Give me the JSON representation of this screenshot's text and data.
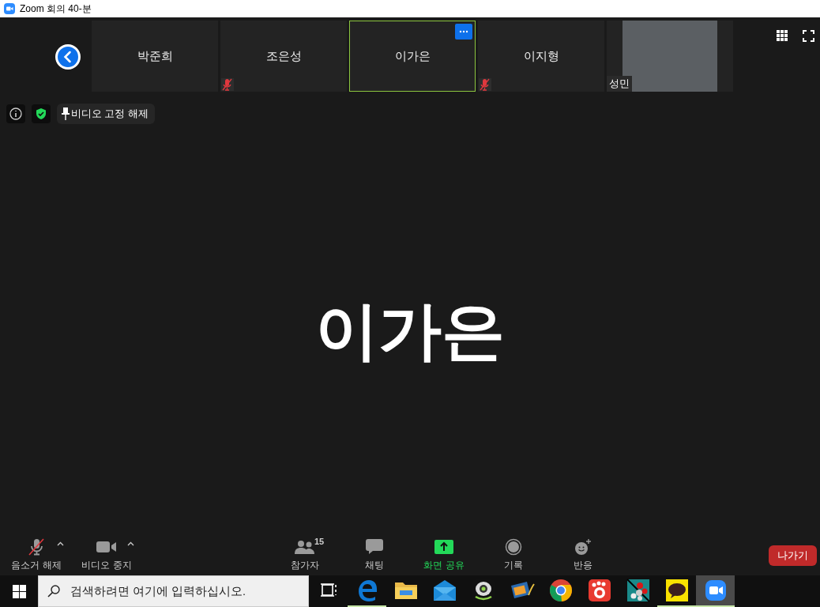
{
  "window": {
    "title": "Zoom 회의 40-분"
  },
  "thumbnails": [
    {
      "name": "박준희",
      "kind": "name",
      "muted": false,
      "selected": false
    },
    {
      "name": "조은성",
      "kind": "name",
      "muted": true,
      "selected": false
    },
    {
      "name": "이가은",
      "kind": "name",
      "muted": false,
      "selected": true
    },
    {
      "name": "이지형",
      "kind": "name",
      "muted": true,
      "selected": false
    },
    {
      "name": "성민",
      "kind": "video",
      "muted": false,
      "selected": false
    }
  ],
  "pin_label": "비디오 고정 해제",
  "speaker": {
    "name": "이가은"
  },
  "toolbar": {
    "left": [
      {
        "kind": "mic",
        "label": "음소거 해제",
        "muted": true
      },
      {
        "kind": "video",
        "label": "비디오 중지",
        "muted": false
      }
    ],
    "center": [
      {
        "kind": "participants",
        "label": "참가자",
        "count": "15"
      },
      {
        "kind": "chat",
        "label": "채팅"
      },
      {
        "kind": "share",
        "label": "화면 공유"
      },
      {
        "kind": "record",
        "label": "기록"
      },
      {
        "kind": "reaction",
        "label": "반응"
      }
    ],
    "leave": "나가기"
  },
  "taskbar": {
    "search": {
      "placeholder": "검색하려면 여기에 입력하십시오."
    },
    "apps": [
      {
        "kind": "taskview",
        "running": false,
        "active": false
      },
      {
        "kind": "edge",
        "running": true,
        "active": false
      },
      {
        "kind": "folder",
        "running": false,
        "active": false
      },
      {
        "kind": "mail",
        "running": false,
        "active": false
      },
      {
        "kind": "webcam",
        "running": false,
        "active": false
      },
      {
        "kind": "film",
        "running": false,
        "active": false
      },
      {
        "kind": "chrome",
        "running": false,
        "active": false
      },
      {
        "kind": "paw",
        "running": false,
        "active": false
      },
      {
        "kind": "molecule",
        "running": false,
        "active": false
      },
      {
        "kind": "talk",
        "running": true,
        "active": false
      },
      {
        "kind": "zoom",
        "running": true,
        "active": true
      }
    ]
  }
}
